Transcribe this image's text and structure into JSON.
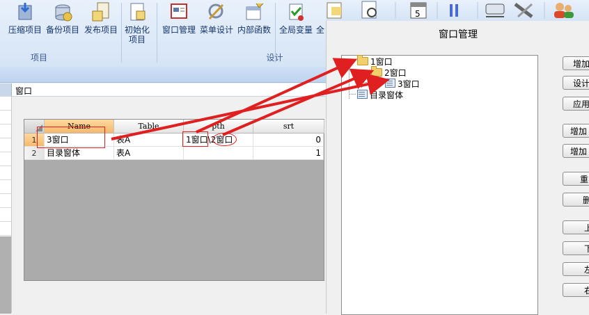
{
  "ribbon": {
    "buttons": [
      {
        "label": "压缩项目",
        "icon": "compress-project-icon"
      },
      {
        "label": "备份项目",
        "icon": "backup-project-icon"
      },
      {
        "label": "发布项目",
        "icon": "publish-project-icon"
      },
      {
        "label": "初始化",
        "label2": "项目",
        "icon": "init-project-icon"
      },
      {
        "label": "窗口管理",
        "icon": "window-manage-icon"
      },
      {
        "label": "菜单设计",
        "icon": "menu-design-icon"
      },
      {
        "label": "内部函数",
        "icon": "internal-function-icon"
      },
      {
        "label": "全局变量",
        "icon": "global-variable-icon"
      },
      {
        "label": "全",
        "icon": "global-icon"
      }
    ],
    "groups": [
      "项目",
      "设计"
    ]
  },
  "toolbar_strip": {
    "icons": [
      "doc-icon",
      "search-doc-icon",
      "calendar-icon",
      "pause-icon",
      "network-icon",
      "tools-icon",
      "users-icon"
    ],
    "calendar_num": "5"
  },
  "workspace": {
    "tab_title": "窗口"
  },
  "table": {
    "columns": [
      "Name",
      "Table",
      "pth",
      "srt"
    ],
    "rows": [
      {
        "num": "1",
        "name": "3窗口",
        "table": "表A",
        "pth": "1窗口\\2窗口",
        "srt": "0"
      },
      {
        "num": "2",
        "name": "目录窗体",
        "table": "表A",
        "pth": "",
        "srt": "1"
      }
    ]
  },
  "dialog": {
    "title": "窗口管理",
    "tree": [
      {
        "label": "1窗口",
        "type": "folder"
      },
      {
        "label": "2窗口",
        "type": "folder"
      },
      {
        "label": "3窗口",
        "type": "form"
      },
      {
        "label": "目录窗体",
        "type": "form"
      }
    ],
    "buttons": [
      "增加",
      "设计",
      "应用",
      "增加",
      "增加",
      "重",
      "删",
      "上",
      "下",
      "左",
      "右"
    ]
  },
  "colors": {
    "accent_orange": "#f5b86c",
    "annotation_red": "#e02020",
    "ribbon_text": "#15356b"
  }
}
